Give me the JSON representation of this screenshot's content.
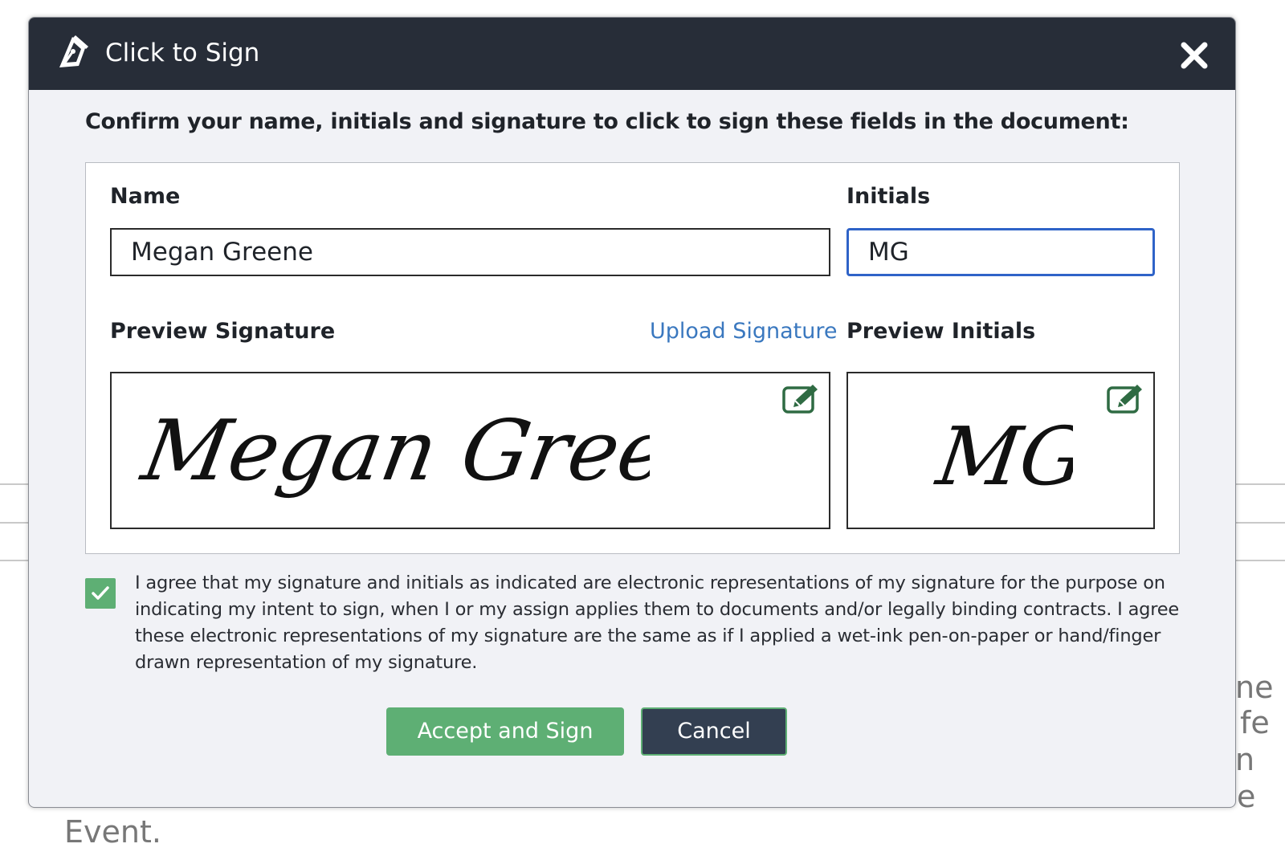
{
  "background": {
    "right_fragments": [
      "ne",
      "fe",
      "n",
      "e"
    ],
    "bottom_text": "Event."
  },
  "modal": {
    "title": "Click to Sign",
    "instruction": "Confirm your name, initials and signature to click to sign these fields in the document:",
    "name_label": "Name",
    "name_value": "Megan Greene",
    "initials_label": "Initials",
    "initials_value": "MG",
    "preview_signature_label": "Preview Signature",
    "upload_signature_link": "Upload Signature",
    "preview_initials_label": "Preview Initials",
    "signature_preview_text": "Megan Greene",
    "initials_preview_text": "MG",
    "agreement_checked": true,
    "agreement_text": "I agree that my signature and initials as indicated are electronic representations of my signature for the purpose on indicating my intent to sign, when I or my assign applies them to documents and/or legally binding contracts. I agree these electronic representations of my signature are the same as if I applied a wet-ink pen-on-paper or hand/finger drawn representation of my signature.",
    "accept_button": "Accept and Sign",
    "cancel_button": "Cancel"
  },
  "colors": {
    "header_bg": "#272d38",
    "accent_green": "#5eaf74",
    "cancel_bg": "#333f51",
    "link_blue": "#3a78bf",
    "focus_blue": "#2f63c8"
  }
}
